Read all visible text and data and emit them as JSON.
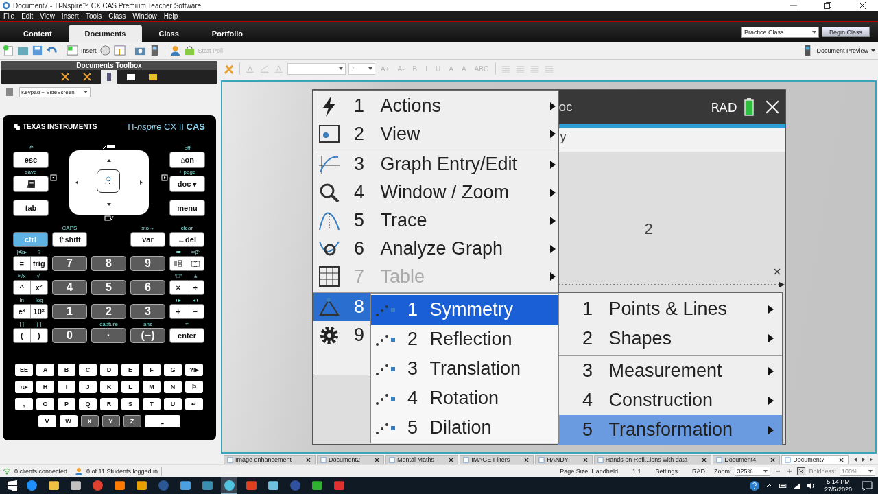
{
  "window": {
    "title": "Document7 - TI-Nspire™ CX CAS Premium Teacher Software"
  },
  "menu_bar": [
    "File",
    "Edit",
    "View",
    "Insert",
    "Tools",
    "Class",
    "Window",
    "Help"
  ],
  "workspace_tabs": [
    {
      "label": "Content",
      "selected": false
    },
    {
      "label": "Documents",
      "selected": true
    },
    {
      "label": "Class",
      "selected": false
    },
    {
      "label": "Portfolio",
      "selected": false
    }
  ],
  "class_select": {
    "value": "Practice Class"
  },
  "begin_class_button": "Begin Class",
  "toolbar": {
    "insert_label": "Insert",
    "start_poll": {
      "label": "Start Poll",
      "disabled": true
    },
    "document_preview": "Document Preview"
  },
  "toolbox": {
    "title": "Documents Toolbox",
    "tabs": [
      {
        "selected": false
      },
      {
        "selected": false
      },
      {
        "selected": true
      },
      {
        "selected": false
      },
      {
        "selected": false
      }
    ],
    "view_select": "Keypad + SideScreen"
  },
  "calculator": {
    "brand": "TEXAS INSTRUMENTS",
    "model": "TI-*nspire* CX II **CAS**",
    "left_keys": [
      {
        "top": "↶",
        "label": "esc",
        "kind": "light"
      },
      {
        "top": "save",
        "kind": "pad"
      },
      {
        "label": "tab",
        "kind": "light"
      }
    ],
    "right_keys": [
      {
        "top": "off",
        "label": "⌂on",
        "kind": "light"
      },
      {
        "top": "+ page",
        "label": "doc ▾",
        "kind": "light"
      },
      {
        "label": "menu",
        "kind": "light"
      }
    ],
    "rows": [
      {
        "slots": [
          {
            "keys": [
              {
                "label": "ctrl",
                "kind": "accent"
              }
            ]
          },
          {
            "keys": [
              {
                "top": "CAPS",
                "label": "⇧shift",
                "kind": "light"
              }
            ]
          },
          {
            "keys": [
              {
                "top": "sto→",
                "label": "var",
                "kind": "light"
              }
            ]
          },
          {
            "keys": [
              {
                "top": "clear",
                "label": "←del",
                "kind": "light"
              }
            ]
          }
        ]
      },
      {
        "slots": [
          {
            "keys": [
              {
                "top": "|≠≥▸",
                "label": "=",
                "kind": "light"
              },
              {
                "top": "?",
                "label": "trig",
                "kind": "light"
              }
            ]
          },
          {
            "keys": [
              {
                "label": "7",
                "kind": "dark"
              }
            ]
          },
          {
            "keys": [
              {
                "label": "8",
                "kind": "dark"
              }
            ]
          },
          {
            "keys": [
              {
                "label": "9",
                "kind": "dark"
              }
            ]
          },
          {
            "keys": [
              {
                "top": "≔",
                "kind": "template"
              },
              {
                "top": "∞β°",
                "kind": "catalog"
              }
            ]
          }
        ]
      },
      {
        "slots": [
          {
            "keys": [
              {
                "top": "ⁿ√x",
                "label": "^",
                "kind": "light"
              },
              {
                "top": "√‾",
                "label": "x²",
                "kind": "light"
              }
            ]
          },
          {
            "keys": [
              {
                "label": "4",
                "kind": "dark"
              }
            ]
          },
          {
            "keys": [
              {
                "label": "5",
                "kind": "dark"
              }
            ]
          },
          {
            "keys": [
              {
                "label": "6",
                "kind": "dark"
              }
            ]
          },
          {
            "keys": [
              {
                "top": "“□”",
                "label": "×",
                "kind": "light"
              },
              {
                "top": "±",
                "label": "÷",
                "kind": "light"
              }
            ]
          }
        ]
      },
      {
        "slots": [
          {
            "keys": [
              {
                "top": "ln",
                "label": "eˣ",
                "kind": "light"
              },
              {
                "top": "log",
                "label": "10ˣ",
                "kind": "light"
              }
            ]
          },
          {
            "keys": [
              {
                "label": "1",
                "kind": "dark"
              }
            ]
          },
          {
            "keys": [
              {
                "label": "2",
                "kind": "dark"
              }
            ]
          },
          {
            "keys": [
              {
                "label": "3",
                "kind": "dark"
              }
            ]
          },
          {
            "keys": [
              {
                "top": "◐▸",
                "label": "+",
                "kind": "light"
              },
              {
                "top": "◂◑",
                "label": "−",
                "kind": "light"
              }
            ]
          }
        ]
      },
      {
        "slots": [
          {
            "keys": [
              {
                "top": "[ ]",
                "label": "(",
                "kind": "light"
              },
              {
                "top": "{ }",
                "label": ")",
                "kind": "light"
              }
            ]
          },
          {
            "keys": [
              {
                "label": "0",
                "kind": "dark"
              }
            ]
          },
          {
            "keys": [
              {
                "top": "capture",
                "label": "·",
                "kind": "dark"
              }
            ]
          },
          {
            "keys": [
              {
                "top": "ans",
                "label": "(−)",
                "kind": "dark"
              }
            ]
          },
          {
            "keys": [
              {
                "top": "≈",
                "label": "enter",
                "kind": "light"
              }
            ]
          }
        ]
      }
    ],
    "alpha_rows": [
      [
        {
          "label": "EE",
          "kind": "light"
        },
        {
          "label": "A",
          "kind": "light"
        },
        {
          "label": "B",
          "kind": "light"
        },
        {
          "label": "C",
          "kind": "light"
        },
        {
          "label": "D",
          "kind": "light"
        },
        {
          "label": "E",
          "kind": "light"
        },
        {
          "label": "F",
          "kind": "light"
        },
        {
          "label": "G",
          "kind": "light"
        },
        {
          "label": "?!▸",
          "kind": "light"
        }
      ],
      [
        {
          "label": "π▸",
          "kind": "light"
        },
        {
          "label": "H",
          "kind": "light"
        },
        {
          "label": "I",
          "kind": "light"
        },
        {
          "label": "J",
          "kind": "light"
        },
        {
          "label": "K",
          "kind": "light"
        },
        {
          "label": "L",
          "kind": "light"
        },
        {
          "label": "M",
          "kind": "light"
        },
        {
          "label": "N",
          "kind": "light"
        },
        {
          "label": "⚐",
          "kind": "light"
        }
      ],
      [
        {
          "label": ",",
          "kind": "light"
        },
        {
          "label": "O",
          "kind": "light"
        },
        {
          "label": "P",
          "kind": "light"
        },
        {
          "label": "Q",
          "kind": "light"
        },
        {
          "label": "R",
          "kind": "light"
        },
        {
          "label": "S",
          "kind": "light"
        },
        {
          "label": "T",
          "kind": "light"
        },
        {
          "label": "U",
          "kind": "light"
        },
        {
          "label": "↵",
          "kind": "light"
        }
      ],
      [
        {
          "label": "V",
          "kind": "light"
        },
        {
          "label": "W",
          "kind": "light"
        },
        {
          "label": "X",
          "kind": "dark"
        },
        {
          "label": "Y",
          "kind": "dark"
        },
        {
          "label": "Z",
          "kind": "dark"
        },
        {
          "label": "⎵",
          "kind": "space"
        }
      ]
    ]
  },
  "format_toolbar": {
    "disabled": true,
    "font_size": "7",
    "buttons": [
      "A+",
      "A-",
      "B",
      "I",
      "U",
      "A",
      "A",
      "ABC"
    ]
  },
  "screen": {
    "header_fragment": "oc",
    "mode": "RAD",
    "entry_fragment": "y",
    "graph_label": "2"
  },
  "main_menu": {
    "items": [
      {
        "number": "1",
        "label": "Actions",
        "disabled": false,
        "selected": false,
        "separator": false
      },
      {
        "number": "2",
        "label": "View",
        "disabled": false,
        "selected": false,
        "separator": true
      },
      {
        "number": "3",
        "label": "Graph Entry/Edit",
        "disabled": false,
        "selected": false,
        "separator": false
      },
      {
        "number": "4",
        "label": "Window / Zoom",
        "disabled": false,
        "selected": false,
        "separator": false
      },
      {
        "number": "5",
        "label": "Trace",
        "disabled": false,
        "selected": false,
        "separator": false
      },
      {
        "number": "6",
        "label": "Analyze Graph",
        "disabled": false,
        "selected": false,
        "separator": false
      },
      {
        "number": "7",
        "label": "Table",
        "disabled": true,
        "selected": false,
        "separator": true
      },
      {
        "number": "8",
        "disabled": false,
        "selected": true,
        "separator": false
      },
      {
        "number": "9",
        "disabled": false,
        "selected": false,
        "separator": false
      }
    ]
  },
  "transformation_menu": {
    "items": [
      {
        "number": "1",
        "label": "Symmetry",
        "selected": true
      },
      {
        "number": "2",
        "label": "Reflection",
        "selected": false
      },
      {
        "number": "3",
        "label": "Translation",
        "selected": false
      },
      {
        "number": "4",
        "label": "Rotation",
        "selected": false
      },
      {
        "number": "5",
        "label": "Dilation",
        "selected": false
      }
    ]
  },
  "geometry_menu": {
    "items": [
      {
        "number": "1",
        "label": "Points & Lines",
        "selected": false,
        "separator": false
      },
      {
        "number": "2",
        "label": "Shapes",
        "selected": false,
        "separator": true
      },
      {
        "number": "3",
        "label": "Measurement",
        "selected": false,
        "separator": false
      },
      {
        "number": "4",
        "label": "Construction",
        "selected": false,
        "separator": false
      },
      {
        "number": "5",
        "label": "Transformation",
        "selected": true,
        "separator": false
      }
    ]
  },
  "doc_tabs": [
    {
      "label": "Image enhancement",
      "selected": false
    },
    {
      "label": "Document2",
      "selected": false
    },
    {
      "label": "Mental Maths",
      "selected": false
    },
    {
      "label": "IMAGE Filters",
      "selected": false
    },
    {
      "label": "HANDY",
      "selected": false
    },
    {
      "label": "Hands on Refl...ions with data",
      "selected": false
    },
    {
      "label": "Document4",
      "selected": false
    },
    {
      "label": "Document7",
      "selected": true
    }
  ],
  "status_bar": {
    "clients": "0 clients connected",
    "students": "0 of 11 Students logged in",
    "page_size": "Page Size: Handheld",
    "page": "1.1",
    "settings": "Settings",
    "mode": "RAD",
    "zoom_label": "Zoom:",
    "zoom": "325%",
    "boldness_label": "Boldness:",
    "boldness": "100%",
    "boldness_disabled": true
  },
  "taskbar": {
    "apps": [
      {
        "active": false
      },
      {
        "active": false
      },
      {
        "active": false
      },
      {
        "active": false
      },
      {
        "active": false
      },
      {
        "active": false
      },
      {
        "active": false
      },
      {
        "active": false
      },
      {
        "active": false
      },
      {
        "active": true
      },
      {
        "active": false
      },
      {
        "active": false
      },
      {
        "active": false
      },
      {
        "active": false
      },
      {
        "active": false
      }
    ],
    "time": "5:14 PM",
    "date": "27/5/2020"
  }
}
